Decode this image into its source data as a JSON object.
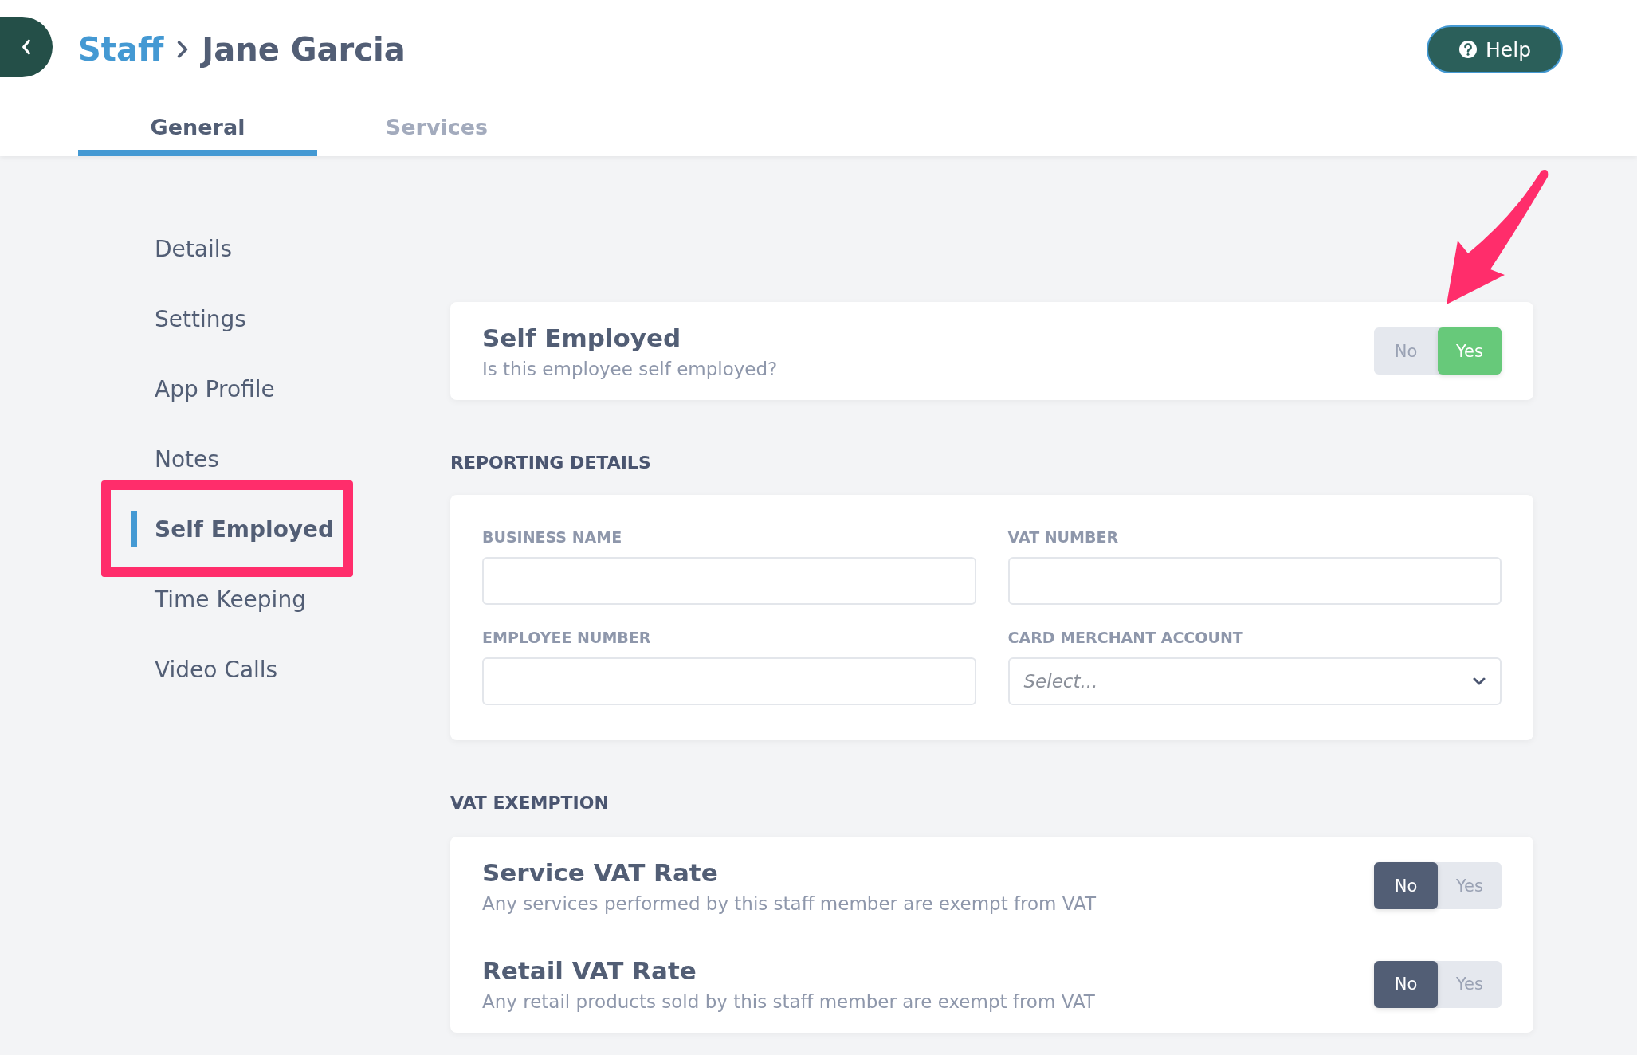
{
  "header": {
    "breadcrumb": {
      "parent": "Staff",
      "current": "Jane Garcia"
    },
    "help_button": {
      "label": "Help"
    }
  },
  "tabs": [
    {
      "label": "General",
      "selected": true
    },
    {
      "label": "Services",
      "selected": false
    }
  ],
  "sidebar": {
    "items": [
      {
        "label": "Details",
        "selected": false
      },
      {
        "label": "Settings",
        "selected": false
      },
      {
        "label": "App Profile",
        "selected": false
      },
      {
        "label": "Notes",
        "selected": false
      },
      {
        "label": "Self Employed",
        "selected": true
      },
      {
        "label": "Time Keeping",
        "selected": false
      },
      {
        "label": "Video Calls",
        "selected": false
      }
    ]
  },
  "self_employed": {
    "title": "Self Employed",
    "subtitle": "Is this employee self employed?",
    "options": [
      {
        "kind": "no",
        "label": "No",
        "selected": false
      },
      {
        "kind": "yes",
        "label": "Yes",
        "selected": true
      }
    ]
  },
  "reporting_details": {
    "heading": "REPORTING DETAILS",
    "fields": [
      {
        "kind": "text",
        "label": "BUSINESS NAME"
      },
      {
        "kind": "text",
        "label": "VAT NUMBER"
      },
      {
        "kind": "text",
        "label": "EMPLOYEE NUMBER"
      },
      {
        "kind": "select",
        "label": "CARD MERCHANT ACCOUNT",
        "placeholder": "Select..."
      }
    ]
  },
  "vat_exemption": {
    "heading": "VAT EXEMPTION",
    "rows": [
      {
        "title": "Service VAT Rate",
        "subtitle": "Any services performed by this staff member are exempt from VAT",
        "options": [
          {
            "kind": "no",
            "label": "No",
            "selected": true
          },
          {
            "kind": "yes",
            "label": "Yes",
            "selected": false
          }
        ]
      },
      {
        "title": "Retail VAT Rate",
        "subtitle": "Any retail products sold by this staff member are exempt from VAT",
        "options": [
          {
            "kind": "no",
            "label": "No",
            "selected": true
          },
          {
            "kind": "yes",
            "label": "Yes",
            "selected": false
          }
        ]
      }
    ]
  }
}
